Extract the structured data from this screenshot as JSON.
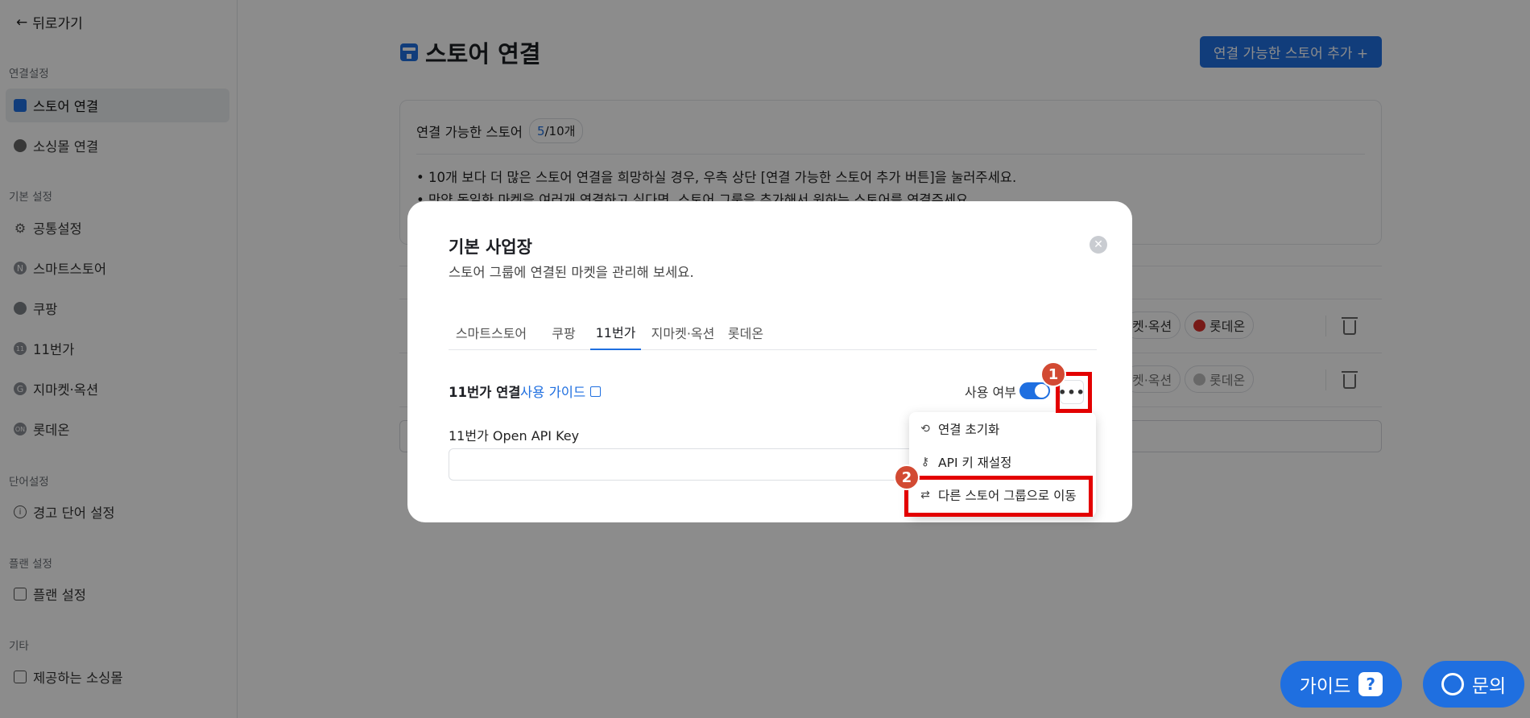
{
  "sidebar": {
    "back": "뒤로가기",
    "sections": [
      {
        "title": "연결설정",
        "items": [
          {
            "label": "스토어 연결",
            "active": true,
            "icon": "store-icon"
          },
          {
            "label": "소싱몰 연결",
            "icon": "globe-icon"
          }
        ]
      },
      {
        "title": "기본 설정",
        "items": [
          {
            "label": "공통설정",
            "icon": "gear-icon"
          },
          {
            "label": "스마트스토어",
            "icon": "naver-icon"
          },
          {
            "label": "쿠팡",
            "icon": "coupang-icon"
          },
          {
            "label": "11번가",
            "icon": "11st-icon"
          },
          {
            "label": "지마켓·옥션",
            "icon": "gmarket-auction-icon"
          },
          {
            "label": "롯데온",
            "icon": "lotteon-icon"
          }
        ]
      },
      {
        "title": "단어설정",
        "items": [
          {
            "label": "경고 단어 설정",
            "icon": "info-icon"
          }
        ]
      },
      {
        "title": "플랜 설정",
        "items": [
          {
            "label": "플랜 설정",
            "icon": "card-icon"
          }
        ]
      },
      {
        "title": "기타",
        "items": [
          {
            "label": "제공하는 소싱몰",
            "icon": "building-icon"
          }
        ]
      }
    ]
  },
  "header": {
    "title": "스토어 연결",
    "add_button": "연결 가능한 스토어 추가 +"
  },
  "store_card": {
    "label": "연결 가능한 스토어",
    "count": "5",
    "total": "/10개",
    "notices": [
      "• 10개 보다 더 많은 스토어 연결을 희망하실 경우, 우측 상단 [연결 가능한 스토어 추가 버튼]을 눌러주세요.",
      "• 만약 동일한 마켓을 여러개 연결하고 싶다면, 스토어 그룹을 추가해서 원하는 스토어를 연결주세요."
    ]
  },
  "store_rows": [
    {
      "chip_partial": "켓·옥션",
      "chip_lotte": "롯데온",
      "lotte_active": true
    },
    {
      "chip_partial": "켓·옥션",
      "chip_lotte": "롯데온",
      "lotte_active": false
    }
  ],
  "modal": {
    "title": "기본 사업장",
    "subtitle": "스토어 그룹에 연결된 마켓을 관리해 보세요.",
    "tabs": [
      "스마트스토어",
      "쿠팡",
      "11번가",
      "지마켓·옥션",
      "롯데온"
    ],
    "active_tab": "11번가",
    "connection_label": "11번가 연결",
    "guide_link": "사용 가이드",
    "use_label": "사용 여부",
    "use_enabled": true,
    "more_label": "•••",
    "api_key_label": "11번가 Open API Key",
    "api_key_value": "",
    "menu": [
      {
        "label": "연결 초기화",
        "icon": "reset-icon"
      },
      {
        "label": "API 키 재설정",
        "icon": "key-icon"
      },
      {
        "label": "다른 스토어 그룹으로 이동",
        "icon": "swap-icon"
      }
    ]
  },
  "annotations": {
    "step1": "1",
    "step2": "2",
    "highlight_color": "#e30000",
    "badge_color": "#d24a33"
  },
  "fabs": {
    "guide": "가이드",
    "guide_glyph": "?",
    "inquiry": "문의"
  },
  "colors": {
    "accent": "#1f6fe0",
    "overlay": "rgba(0,0,0,0.45)"
  }
}
